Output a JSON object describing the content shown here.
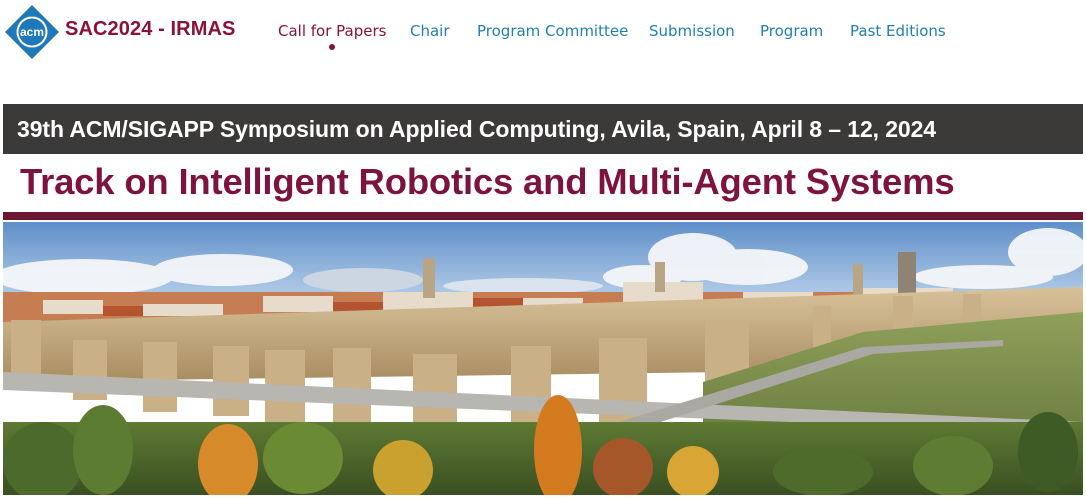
{
  "header": {
    "logo_text": "acm",
    "site_title": "SAC2024 - IRMAS",
    "nav": [
      {
        "label": "Call for Papers",
        "active": true
      },
      {
        "label": "Chair",
        "active": false
      },
      {
        "label": "Program Committee",
        "active": false
      },
      {
        "label": "Submission",
        "active": false
      },
      {
        "label": "Program",
        "active": false
      },
      {
        "label": "Past Editions",
        "active": false
      }
    ]
  },
  "banner": {
    "conference_line": "39th ACM/SIGAPP Symposium on Applied Computing, Avila, Spain, April 8 – 12, 2024",
    "track_title": "Track on Intelligent Robotics and Multi-Agent Systems",
    "photo_subject": "avila-city-walls-photo"
  },
  "colors": {
    "brand_maroon": "#8a1238",
    "link_blue": "#1f7fb3",
    "acm_blue": "#1f78b9",
    "banner_dark": "#3b3a39"
  }
}
